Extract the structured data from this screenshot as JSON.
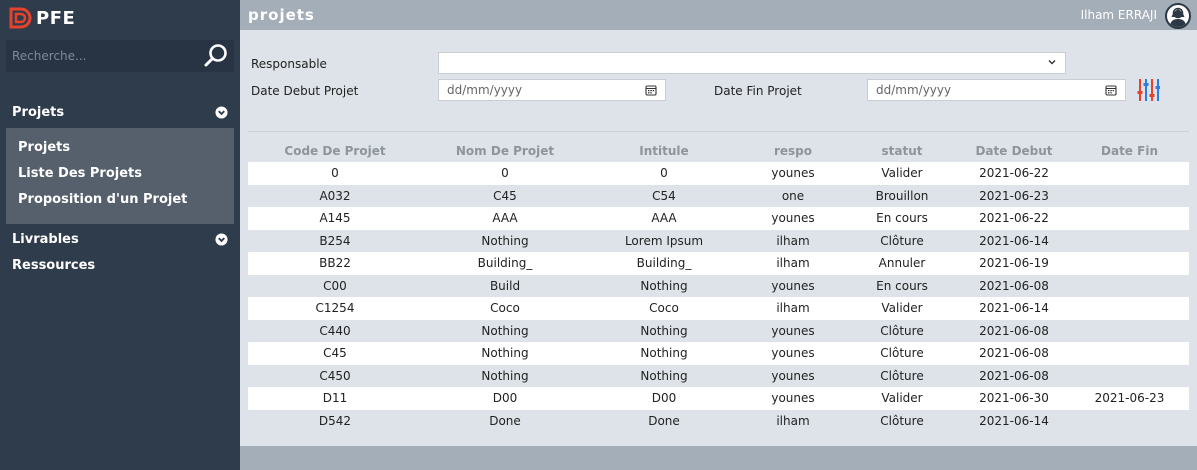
{
  "app": {
    "logo_text": "PFE"
  },
  "sidebar": {
    "search_placeholder": "Recherche...",
    "sections": [
      {
        "label": "Projets",
        "expanded": true
      },
      {
        "label": "Livrables",
        "expanded": false
      }
    ],
    "submenu": [
      "Projets",
      "Liste Des Projets",
      "Proposition d'un Projet"
    ],
    "ressources": "Ressources"
  },
  "header": {
    "title": "projets",
    "user": "Ilham ERRAJI"
  },
  "filters": {
    "responsable_label": "Responsable",
    "responsable_value": "",
    "date_debut_label": "Date Debut Projet",
    "date_fin_label": "Date Fin Projet",
    "date_placeholder": "dd/mm/yyyy"
  },
  "table": {
    "columns": [
      "Code De Projet",
      "Nom De Projet",
      "Intitule",
      "respo",
      "statut",
      "Date Debut",
      "Date Fin"
    ],
    "rows": [
      [
        "0",
        "0",
        "0",
        "younes",
        "Valider",
        "2021-06-22",
        ""
      ],
      [
        "A032",
        "C45",
        "C54",
        "one",
        "Brouillon",
        "2021-06-23",
        ""
      ],
      [
        "A145",
        "AAA",
        "AAA",
        "younes",
        "En cours",
        "2021-06-22",
        ""
      ],
      [
        "B254",
        "Nothing",
        "Lorem Ipsum",
        "ilham",
        "Clôture",
        "2021-06-14",
        ""
      ],
      [
        "BB22",
        "Building_",
        "Building_",
        "ilham",
        "Annuler",
        "2021-06-19",
        ""
      ],
      [
        "C00",
        "Build",
        "Nothing",
        "younes",
        "En cours",
        "2021-06-08",
        ""
      ],
      [
        "C1254",
        "Coco",
        "Coco",
        "ilham",
        "Valider",
        "2021-06-14",
        ""
      ],
      [
        "C440",
        "Nothing",
        "Nothing",
        "younes",
        "Clôture",
        "2021-06-08",
        ""
      ],
      [
        "C45",
        "Nothing",
        "Nothing",
        "younes",
        "Clôture",
        "2021-06-08",
        ""
      ],
      [
        "C450",
        "Nothing",
        "Nothing",
        "younes",
        "Clôture",
        "2021-06-08",
        ""
      ],
      [
        "D11",
        "D00",
        "D00",
        "younes",
        "Valider",
        "2021-06-30",
        "2021-06-23"
      ],
      [
        "D542",
        "Done",
        "Done",
        "ilham",
        "Clôture",
        "2021-06-14",
        ""
      ]
    ]
  },
  "colors": {
    "sidebar": "#2f3c4c",
    "accent": "#e8412c",
    "topbar": "#a4aeb8",
    "settings_blue": "#2a7de1"
  },
  "icons": {
    "logo": "logo-icon",
    "search": "search-icon",
    "chevron": "chevron-down-icon",
    "calendar": "calendar-icon",
    "settings": "sliders-icon",
    "avatar": "avatar-icon"
  }
}
